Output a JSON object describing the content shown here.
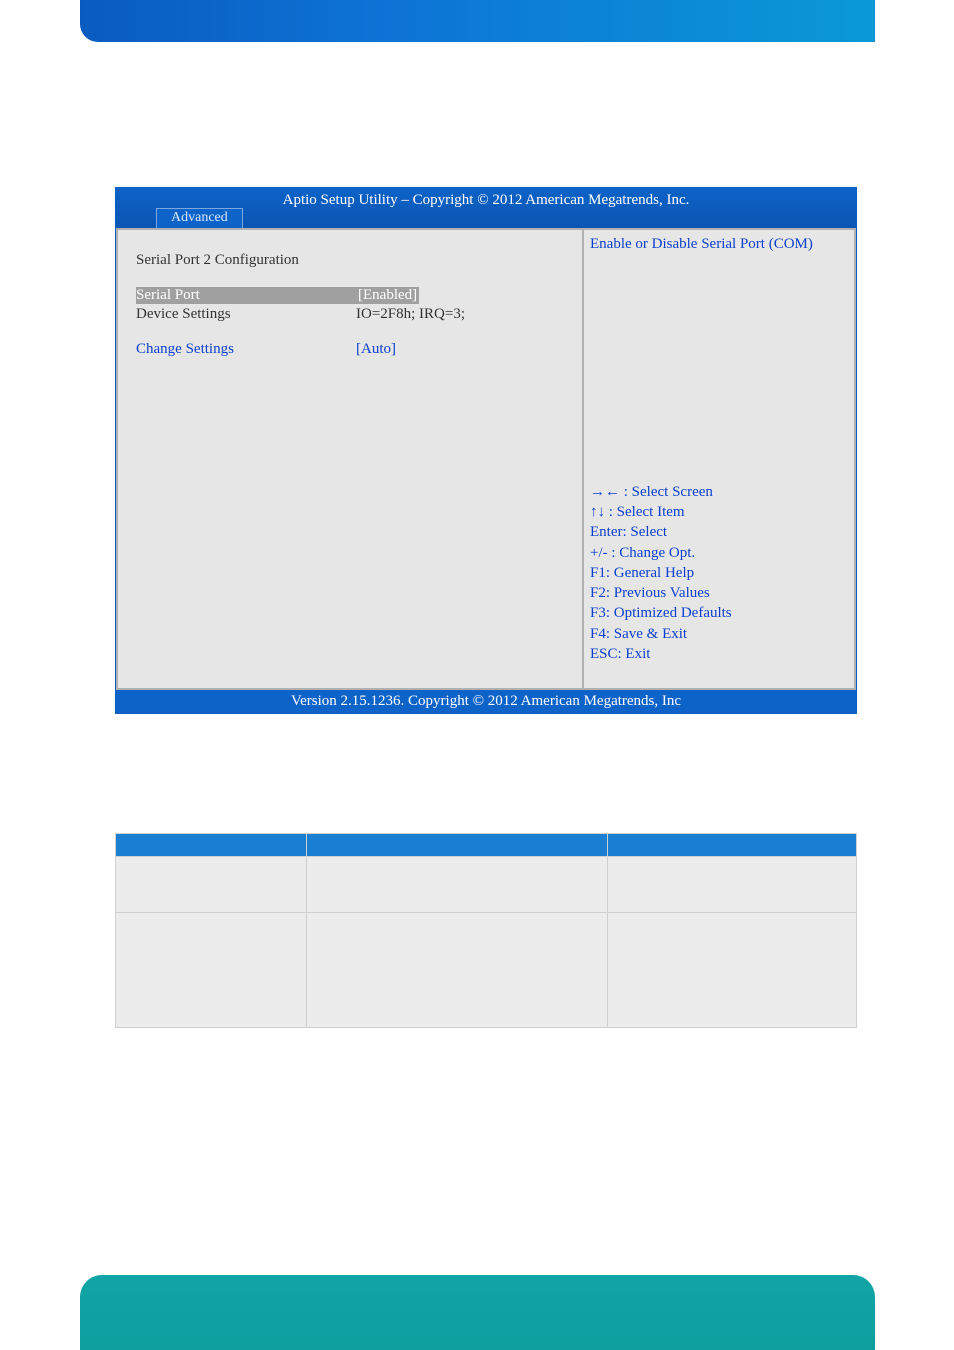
{
  "bios": {
    "title": "Aptio Setup Utility  –  Copyright © 2012 American Megatrends, Inc.",
    "tab": "Advanced",
    "section_heading": "Serial Port 2 Configuration",
    "rows": {
      "serial_port": {
        "label": "Serial Port",
        "value": "[Enabled]"
      },
      "device_settings": {
        "label": "Device Settings",
        "value": "IO=2F8h; IRQ=3;"
      },
      "change_settings": {
        "label": "Change Settings",
        "value": "[Auto]"
      }
    },
    "help_text": "Enable or Disable Serial Port (COM)",
    "hotkeys": [
      "→← : Select Screen",
      "↑↓ : Select Item",
      "Enter: Select",
      "+/- : Change Opt.",
      "F1: General Help",
      "F2: Previous Values",
      "F3: Optimized Defaults",
      "F4: Save & Exit",
      "ESC: Exit"
    ],
    "footer": "Version 2.15.1236. Copyright © 2012 American Megatrends, Inc"
  }
}
